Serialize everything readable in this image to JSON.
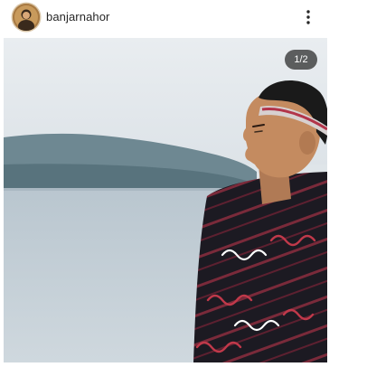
{
  "post": {
    "username": "banjarnahor",
    "media_counter": "1/2",
    "more_icon": "more-vertical-icon",
    "photo_description_icon": "photo"
  },
  "colors": {
    "username_text": "#262626",
    "counter_bg": "#262626",
    "counter_text": "#ffffff",
    "sky": "#e6ebee",
    "water": "#c9d3da",
    "hills": "#6f8a94",
    "cloth": "#1c1a22",
    "cloth_pattern_red": "#b23a4a"
  }
}
